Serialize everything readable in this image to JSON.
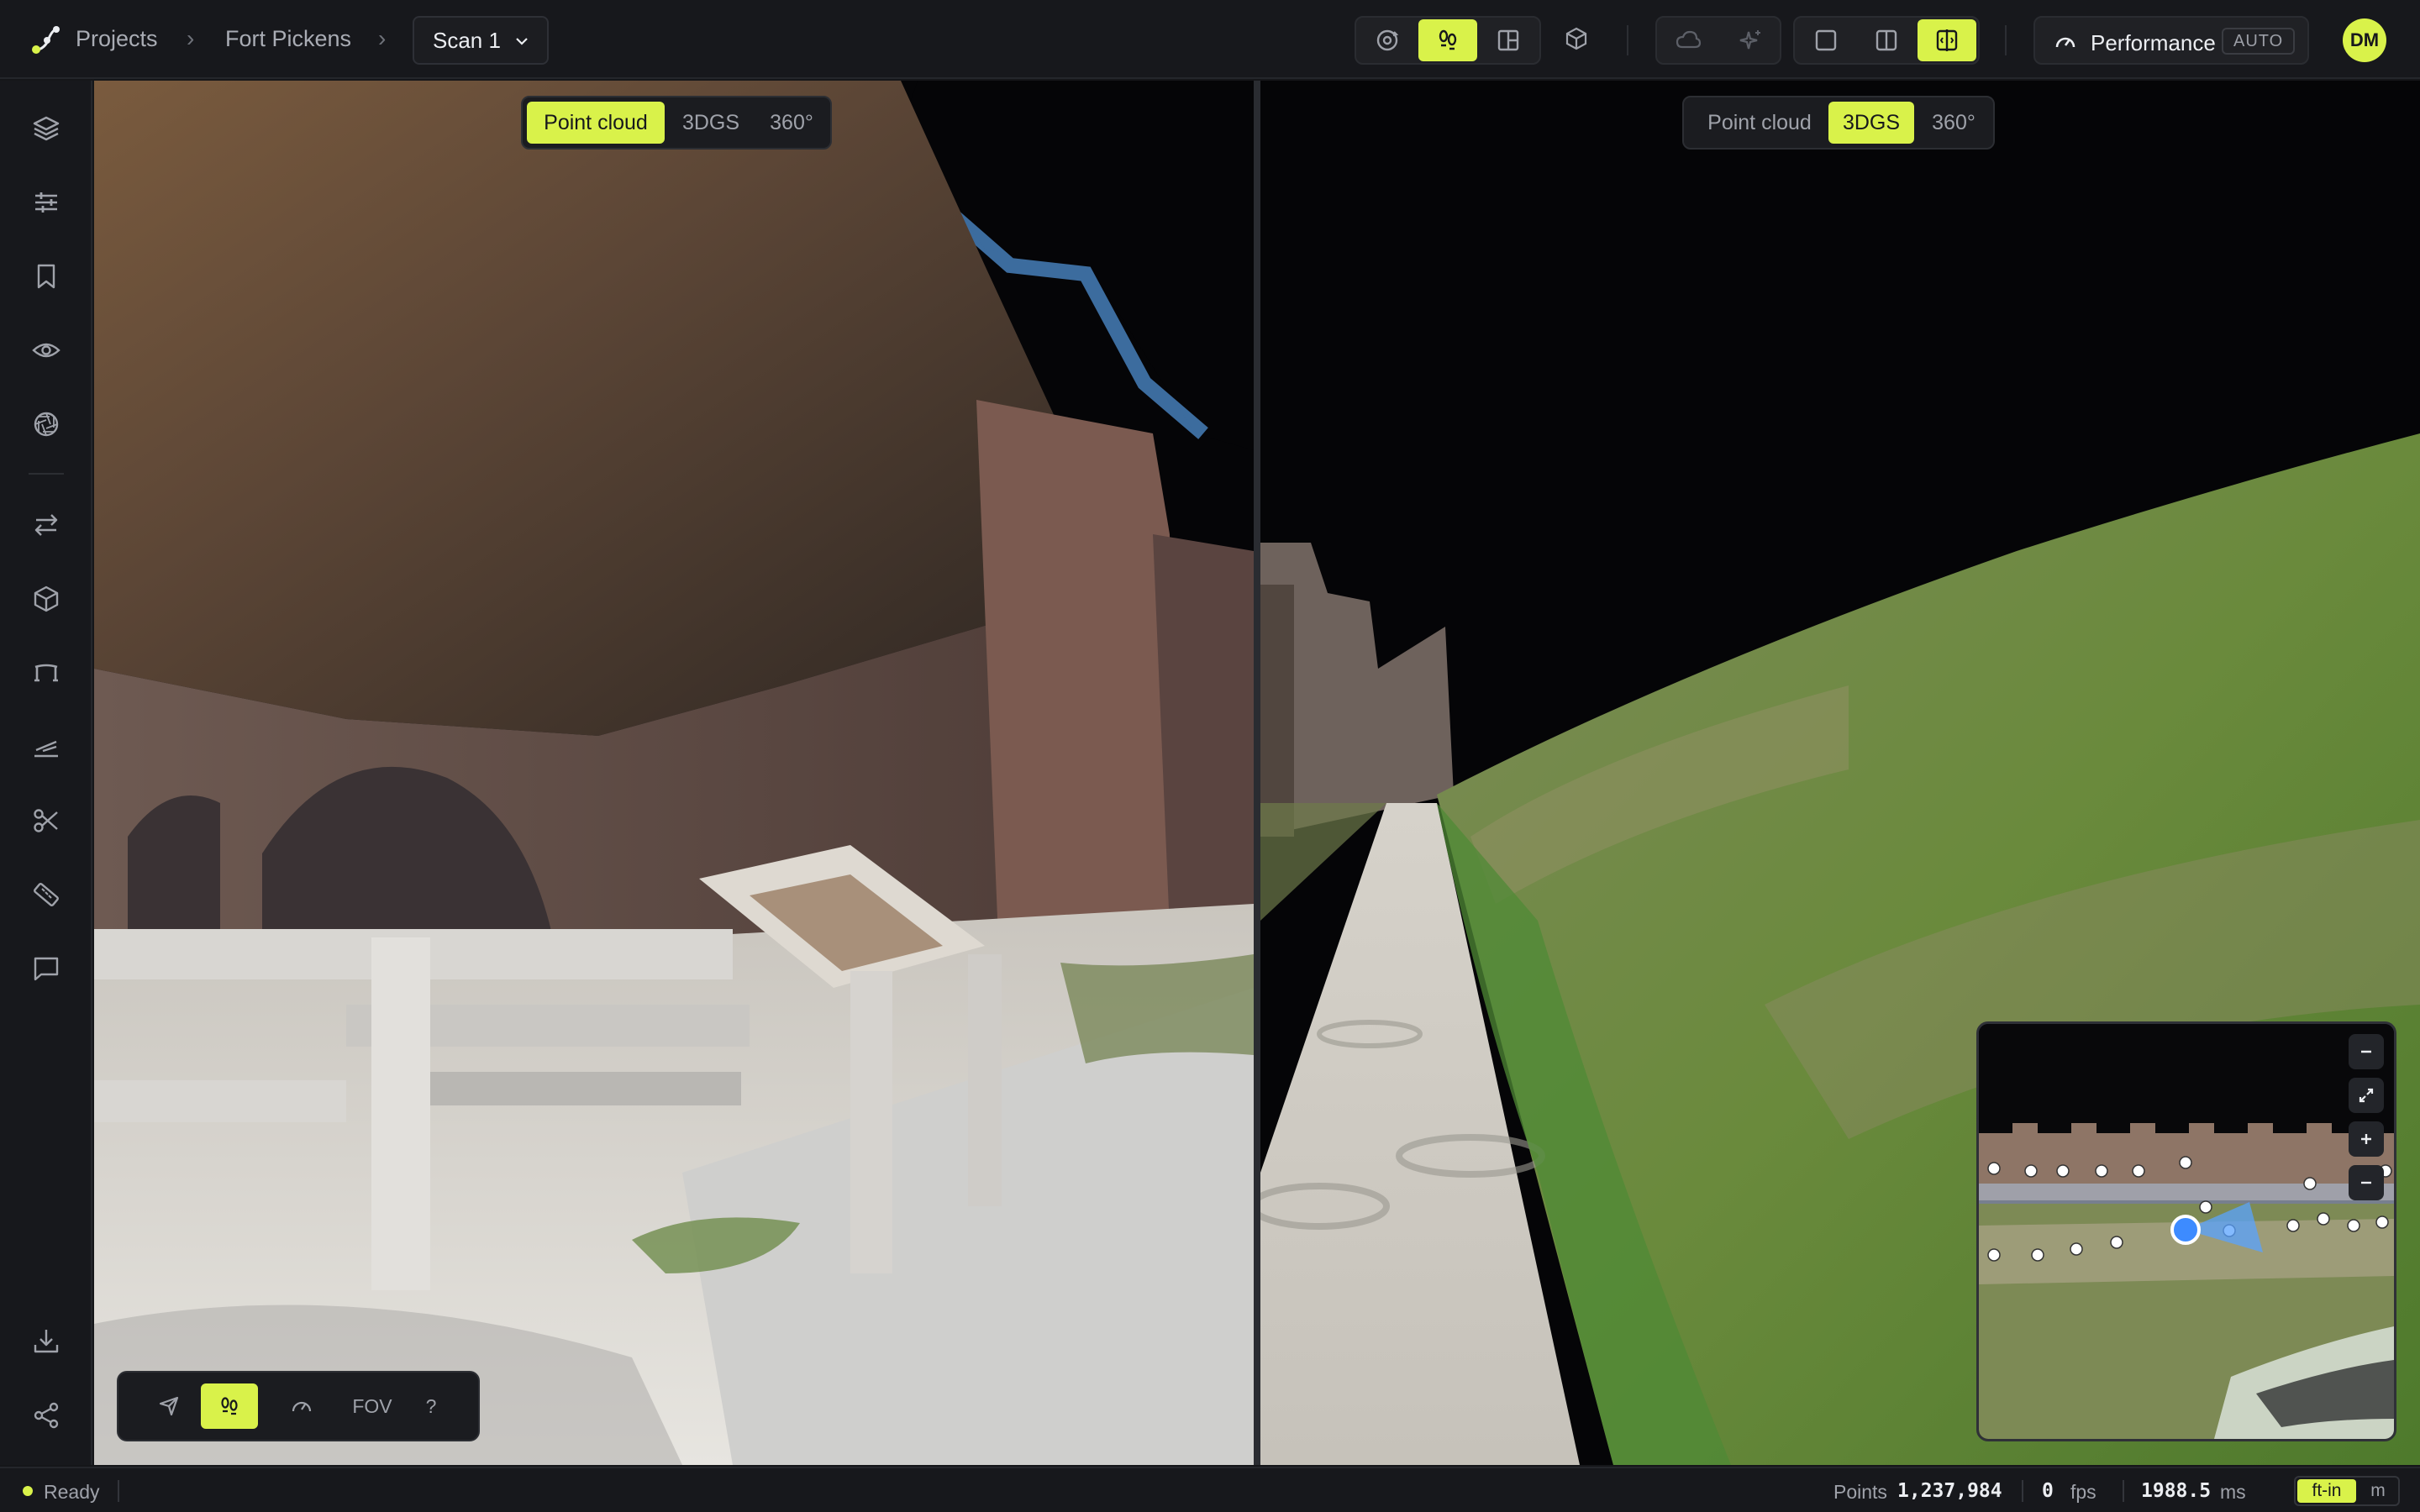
{
  "breadcrumb": {
    "projects": "Projects",
    "project": "Fort Pickens",
    "scan": "Scan 1"
  },
  "toolbar": {
    "group1": [
      {
        "icon": "orbit-icon",
        "active": false
      },
      {
        "icon": "walk-icon",
        "active": true
      },
      {
        "icon": "layout-icon",
        "active": false
      }
    ],
    "model_icon": "cube-icon",
    "group2": [
      {
        "icon": "cloud-icon",
        "active": false
      },
      {
        "icon": "sparkle-icon",
        "active": false
      }
    ],
    "group3": [
      {
        "icon": "single-view-icon",
        "active": false
      },
      {
        "icon": "split-view-icon",
        "active": false
      },
      {
        "icon": "compare-view-icon",
        "active": true
      }
    ]
  },
  "performance": {
    "label": "Performance",
    "badge": "AUTO"
  },
  "user": {
    "initials": "DM"
  },
  "sidebar": [
    {
      "icon": "layers-icon"
    },
    {
      "icon": "sliders-icon"
    },
    {
      "icon": "bookmark-icon"
    },
    {
      "icon": "eye-icon"
    },
    {
      "icon": "aperture-icon"
    },
    {
      "icon": "swap-icon"
    },
    {
      "icon": "box-icon"
    },
    {
      "icon": "path-icon"
    },
    {
      "icon": "terrain-icon"
    },
    {
      "icon": "scissors-icon"
    },
    {
      "icon": "measure-icon"
    },
    {
      "icon": "comment-icon"
    },
    {
      "icon": "download-icon"
    },
    {
      "icon": "share-icon"
    }
  ],
  "left_view": {
    "modes": [
      "Point cloud",
      "3DGS",
      "360°"
    ],
    "selected": "Point cloud"
  },
  "right_view": {
    "modes": [
      "Point cloud",
      "3DGS",
      "360°"
    ],
    "selected": "3DGS"
  },
  "nav": {
    "fov": "FOV",
    "help": "?"
  },
  "status": {
    "state": "Ready",
    "points_label": "Points",
    "points": "1,237,984",
    "fps_value": "0",
    "fps_label": "fps",
    "ms_value": "1988.5",
    "ms_label": "ms",
    "units": [
      "ft-in",
      "m"
    ],
    "unit_selected": "ft-in"
  },
  "colors": {
    "accent": "#d9f24a",
    "background": "#151619",
    "panel": "#17181c"
  }
}
